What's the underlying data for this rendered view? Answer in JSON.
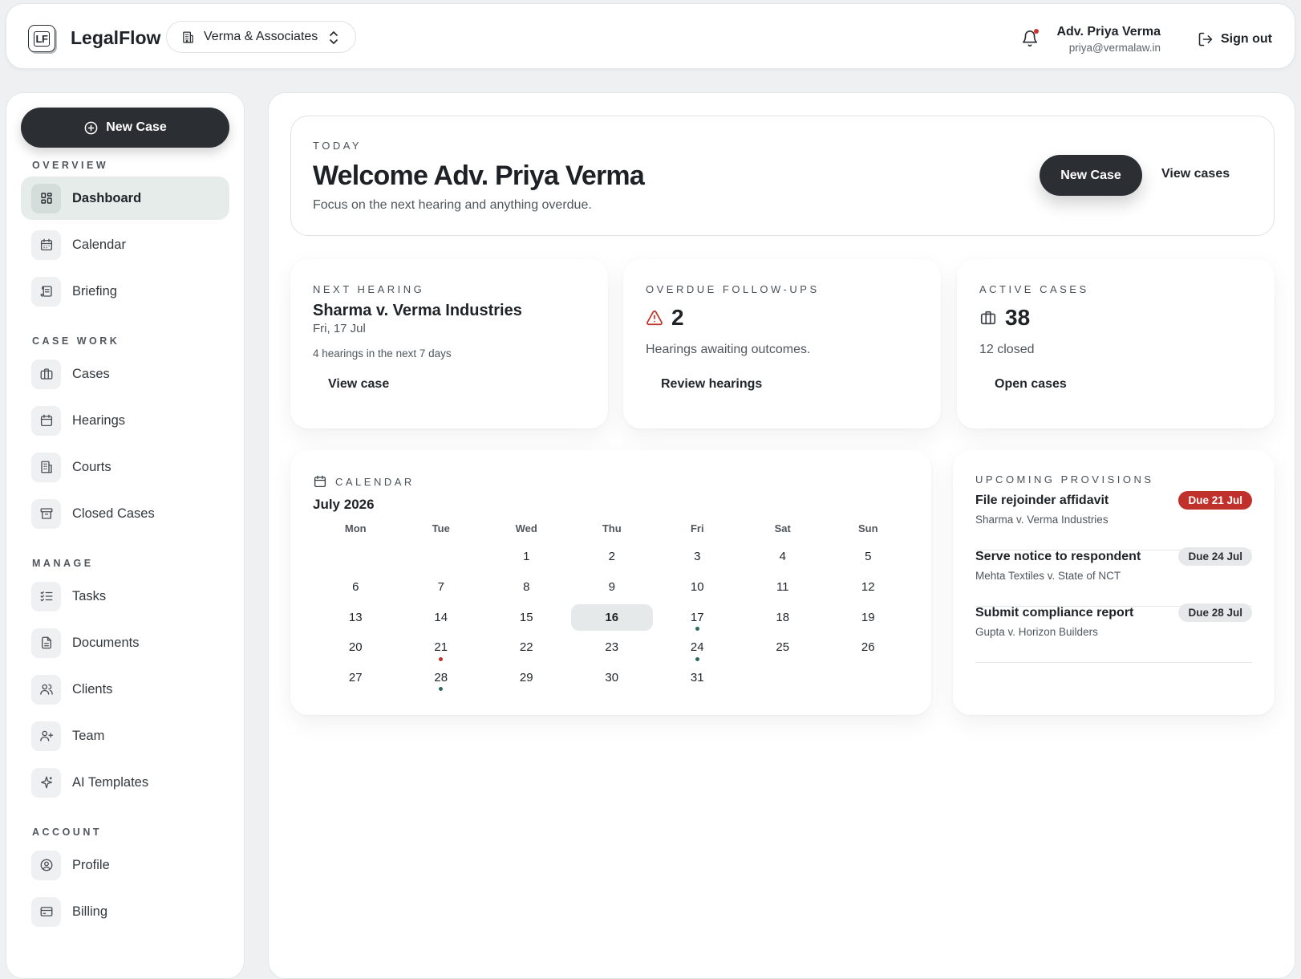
{
  "app": {
    "logo_text": "LF",
    "name": "LegalFlow"
  },
  "firm_switcher": {
    "label": "Verma & Associates"
  },
  "user": {
    "name": "Adv. Priya Verma",
    "email": "priya@vermalaw.in",
    "signout_label": "Sign out"
  },
  "sidebar": {
    "new_case_label": "New Case",
    "sections": {
      "overview": "OVERVIEW",
      "case_work": "CASE WORK",
      "manage": "MANAGE",
      "account": "ACCOUNT"
    },
    "items": {
      "dashboard": "Dashboard",
      "calendar": "Calendar",
      "briefing": "Briefing",
      "cases": "Cases",
      "hearings": "Hearings",
      "courts": "Courts",
      "closed_cases": "Closed Cases",
      "tasks": "Tasks",
      "documents": "Documents",
      "clients": "Clients",
      "team": "Team",
      "ai_templates": "AI Templates",
      "profile": "Profile",
      "billing": "Billing"
    }
  },
  "welcome": {
    "eyebrow": "TODAY",
    "title": "Welcome Adv. Priya Verma",
    "subtitle": "Focus on the next hearing and anything overdue.",
    "new_case_label": "New Case",
    "view_cases_label": "View cases"
  },
  "next_hearing": {
    "eyebrow": "NEXT HEARING",
    "title": "Sharma v. Verma Industries",
    "date": "Fri, 17 Jul",
    "note": "4 hearings in the next 7 days",
    "link": "View case"
  },
  "overdue": {
    "eyebrow": "OVERDUE FOLLOW-UPS",
    "count": "2",
    "desc": "Hearings awaiting outcomes.",
    "link": "Review hearings"
  },
  "active_cases": {
    "eyebrow": "ACTIVE CASES",
    "count": "38",
    "desc": "12 closed",
    "link": "Open cases"
  },
  "calendar": {
    "eyebrow": "CALENDAR",
    "month": "July 2026",
    "weekdays": [
      "Mon",
      "Tue",
      "Wed",
      "Thu",
      "Fri",
      "Sat",
      "Sun"
    ],
    "weeks": [
      [
        "",
        "",
        "1",
        "2",
        "3",
        "4",
        "5"
      ],
      [
        "6",
        "7",
        "8",
        "9",
        "10",
        "11",
        "12"
      ],
      [
        "13",
        "14",
        "15",
        "16",
        "17",
        "18",
        "19"
      ],
      [
        "20",
        "21",
        "22",
        "23",
        "24",
        "25",
        "26"
      ],
      [
        "27",
        "28",
        "29",
        "30",
        "31",
        "",
        ""
      ]
    ],
    "today": "16",
    "hearing_days": [
      "17",
      "24",
      "28"
    ],
    "deadline_days": [
      "21"
    ],
    "colors": {
      "hearing_dot": "#2e6b5e",
      "deadline_dot": "#c0312b"
    }
  },
  "provisions": {
    "eyebrow": "UPCOMING PROVISIONS",
    "items": [
      {
        "title": "File rejoinder affidavit",
        "case": "Sharma v. Verma Industries",
        "due": "Due 21 Jul",
        "urgent": true
      },
      {
        "title": "Serve notice to respondent",
        "case": "Mehta Textiles v. State of NCT",
        "due": "Due 24 Jul",
        "urgent": false
      },
      {
        "title": "Submit compliance report",
        "case": "Gupta v. Horizon Builders",
        "due": "Due 28 Jul",
        "urgent": false
      }
    ]
  },
  "colors": {
    "primary": "#2b2f33",
    "accent_active": "#e6ece9",
    "danger": "#c0312b",
    "notification_dot": "#d2322d"
  },
  "icons": {
    "firm": "building-icon",
    "switch": "chevron-up-down-icon",
    "bell": "bell-icon",
    "signout": "sign-out-icon",
    "new_case": "plus-circle-icon",
    "dashboard": "grid-icon",
    "calendar": "calendar-icon",
    "briefing": "scroll-icon",
    "cases": "briefcase-icon",
    "hearings": "calendar-icon",
    "courts": "building-icon",
    "closed_cases": "archive-icon",
    "tasks": "checklist-icon",
    "documents": "document-icon",
    "clients": "users-icon",
    "team": "user-plus-icon",
    "ai_templates": "sparkle-icon",
    "profile": "user-circle-icon",
    "billing": "credit-card-icon",
    "overdue": "warning-icon",
    "active": "briefcase-icon"
  }
}
